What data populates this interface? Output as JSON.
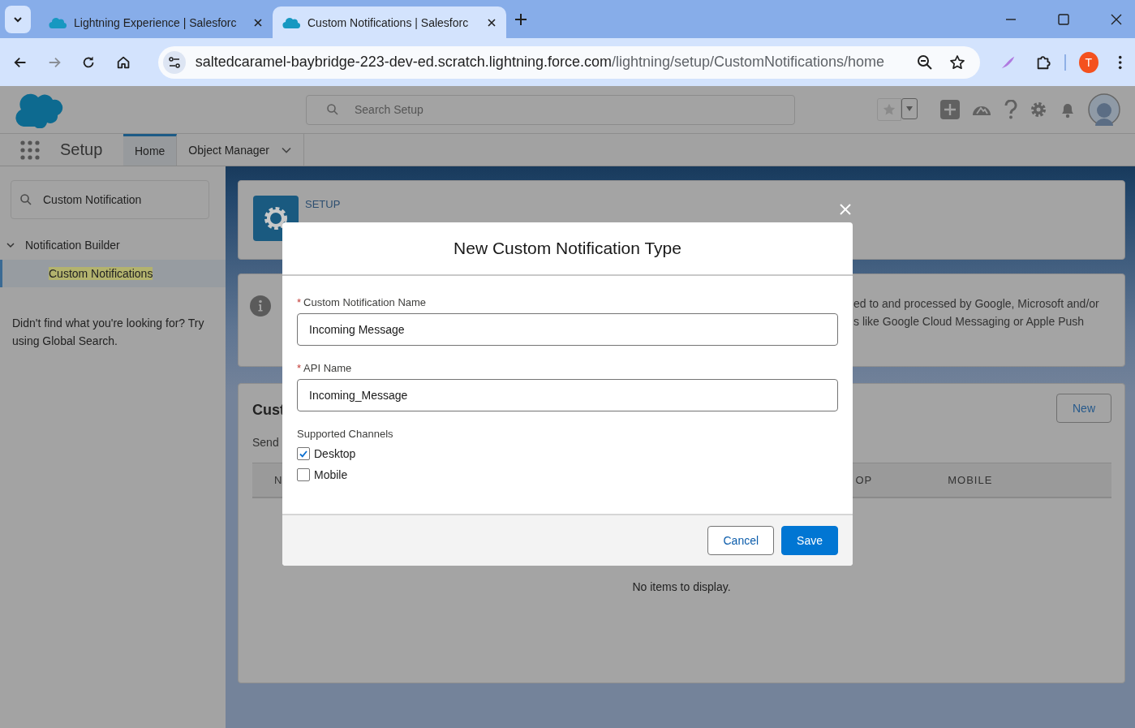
{
  "browser": {
    "tabs": [
      {
        "title": "Lightning Experience | Salesforc",
        "selected": false
      },
      {
        "title": "Custom Notifications | Salesforc",
        "selected": true
      }
    ],
    "url_host": "saltedcaramel-baybridge-223-dev-ed.scratch.lightning.force.com",
    "url_path": "/lightning/setup/CustomNotifications/home",
    "profile_initial": "T"
  },
  "header": {
    "search": {
      "placeholder": "Search Setup"
    }
  },
  "nav": {
    "app_name": "Setup",
    "tabs": [
      {
        "label": "Home",
        "selected": true
      },
      {
        "label": "Object Manager",
        "selected": false
      }
    ]
  },
  "sidebar": {
    "search": {
      "value": "Custom Notification"
    },
    "tree": [
      {
        "label": "Notification Builder",
        "expanded": true,
        "children": [
          {
            "label": "Custom Notifications",
            "selected": true
          }
        ]
      }
    ],
    "help_text": "Didn't find what you're looking for? Try using Global Search."
  },
  "page_header": {
    "eyebrow": "SETUP"
  },
  "info_banner": {
    "text_fragments": [
      "ed to and processed by Google, Microsoft and/or",
      "s like Google Cloud Messaging or Apple Push"
    ]
  },
  "list_card": {
    "title_fragment": "Cust",
    "subtitle_fragment": "Send",
    "new_button": "New",
    "column_fragments": [
      "N",
      "OP",
      "MOBILE"
    ],
    "empty_text": "No items to display."
  },
  "modal": {
    "title": "New Custom Notification Type",
    "fields": [
      {
        "label": "Custom Notification Name",
        "required_mark": "*",
        "value": "Incoming Message"
      },
      {
        "label": "API Name",
        "required_mark": "*",
        "value": "Incoming_Message"
      }
    ],
    "channels": {
      "label": "Supported Channels",
      "options": [
        {
          "label": "Desktop",
          "checked": true
        },
        {
          "label": "Mobile",
          "checked": false
        }
      ]
    },
    "buttons": [
      {
        "label": "Cancel",
        "kind": "neutral"
      },
      {
        "label": "Save",
        "kind": "brand"
      }
    ]
  }
}
